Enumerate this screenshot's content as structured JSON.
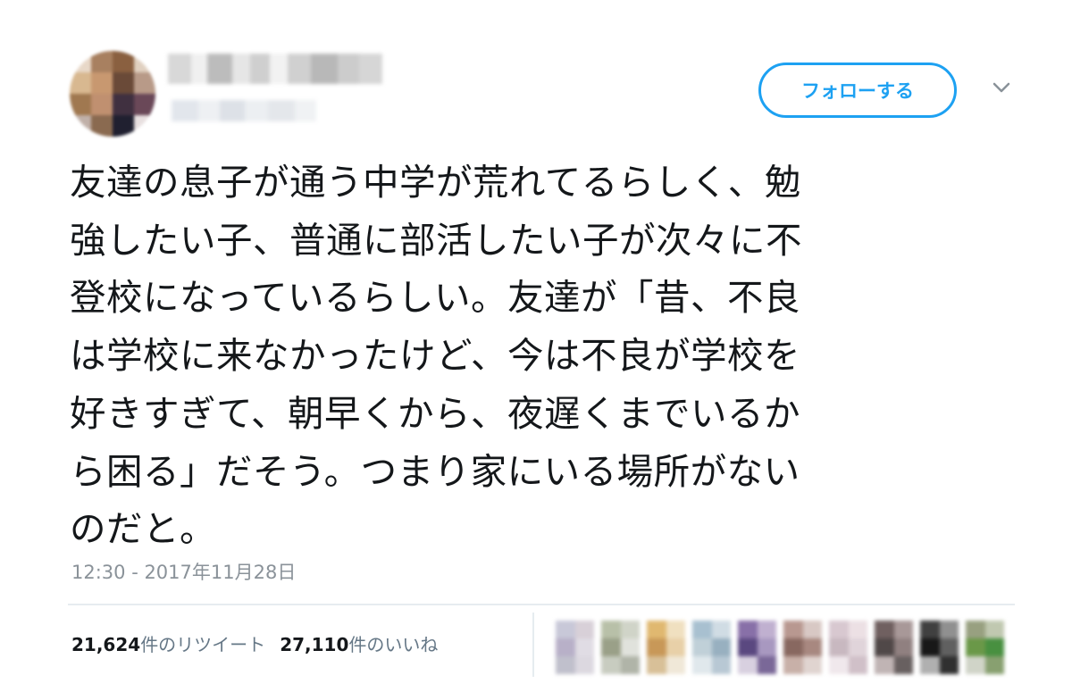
{
  "tweet": {
    "follow_label": "フォローする",
    "text_lines": [
      "友達の息子が通う中学が荒れてるらしく、勉",
      "強したい子、普通に部活したい子が次々に不",
      "登校になっているらしい。友達が「昔、不良",
      "は学校に来なかったけど、今は不良が学校を",
      "好きすぎて、朝早くから、夜遅くまでいるか",
      "ら困る」だそう。つまり家にいる場所がない",
      "のだと。"
    ],
    "timestamp": "12:30 - 2017年11月28日",
    "retweet_count": "21,624",
    "retweet_suffix": "件のリツイート",
    "like_count": "27,110",
    "like_suffix": "件のいいね"
  },
  "icons": {
    "dropdown": "chevron-down-icon"
  },
  "colors": {
    "accent": "#1da1f2",
    "text": "#14171a",
    "muted": "#8a9299"
  }
}
